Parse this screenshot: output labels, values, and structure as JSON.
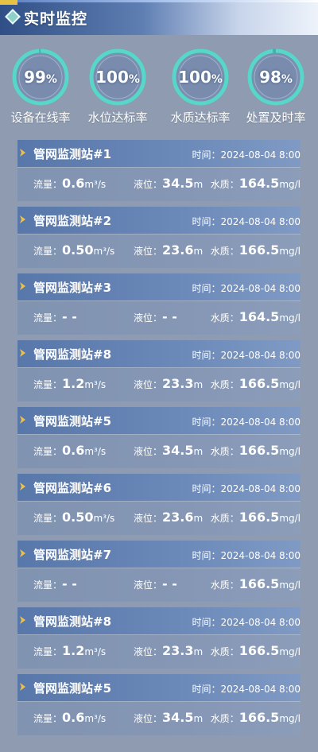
{
  "header": {
    "title": "实时监控"
  },
  "colors": {
    "ring_track": "#40b7b4",
    "ring_fill": "#58d6c7",
    "ring_fill_partial": "#4a72c4",
    "chevron": "#f0c24a"
  },
  "stats": [
    {
      "value": "99",
      "percent": 99,
      "unit": "%",
      "label": "设备在线率"
    },
    {
      "value": "100",
      "percent": 100,
      "unit": "%",
      "label": "水位达标率"
    },
    {
      "value": "100",
      "percent": 100,
      "unit": "%",
      "label": "水质达标率"
    },
    {
      "value": "98",
      "percent": 98,
      "unit": "%",
      "label": "处置及时率"
    }
  ],
  "labels": {
    "time": "时间：",
    "flow": "流量：",
    "level": "液位：",
    "quality": "水质："
  },
  "stations": [
    {
      "name": "管网监测站#1",
      "time": "2024-08-04 8:00",
      "flow": "0.6",
      "flow_unit": "m³/s",
      "level": "34.5",
      "level_unit": "m",
      "quality": "164.5",
      "quality_unit": "mg/l"
    },
    {
      "name": "管网监测站#2",
      "time": "2024-08-04 8:00",
      "flow": "0.50",
      "flow_unit": "m³/s",
      "level": "23.6",
      "level_unit": "m",
      "quality": "166.5",
      "quality_unit": "mg/l"
    },
    {
      "name": "管网监测站#3",
      "time": "2024-08-04 8:00",
      "flow": "- -",
      "flow_unit": "",
      "level": "- -",
      "level_unit": "",
      "quality": "164.5",
      "quality_unit": "mg/l"
    },
    {
      "name": "管网监测站#8",
      "time": "2024-08-04 8:00",
      "flow": "1.2",
      "flow_unit": "m³/s",
      "level": "23.3",
      "level_unit": "m",
      "quality": "166.5",
      "quality_unit": "mg/l"
    },
    {
      "name": "管网监测站#5",
      "time": "2024-08-04 8:00",
      "flow": "0.6",
      "flow_unit": "m³/s",
      "level": "34.5",
      "level_unit": "m",
      "quality": "166.5",
      "quality_unit": "mg/l"
    },
    {
      "name": "管网监测站#6",
      "time": "2024-08-04 8:00",
      "flow": "0.50",
      "flow_unit": "m³/s",
      "level": "23.6",
      "level_unit": "m",
      "quality": "166.5",
      "quality_unit": "mg/l"
    },
    {
      "name": "管网监测站#7",
      "time": "2024-08-04 8:00",
      "flow": "- -",
      "flow_unit": "",
      "level": "- -",
      "level_unit": "",
      "quality": "166.5",
      "quality_unit": "mg/l"
    },
    {
      "name": "管网监测站#8",
      "time": "2024-08-04 8:00",
      "flow": "1.2",
      "flow_unit": "m³/s",
      "level": "23.3",
      "level_unit": "m",
      "quality": "166.5",
      "quality_unit": "mg/l"
    },
    {
      "name": "管网监测站#5",
      "time": "2024-08-04 8:00",
      "flow": "0.6",
      "flow_unit": "m³/s",
      "level": "34.5",
      "level_unit": "m",
      "quality": "166.5",
      "quality_unit": "mg/l"
    }
  ]
}
